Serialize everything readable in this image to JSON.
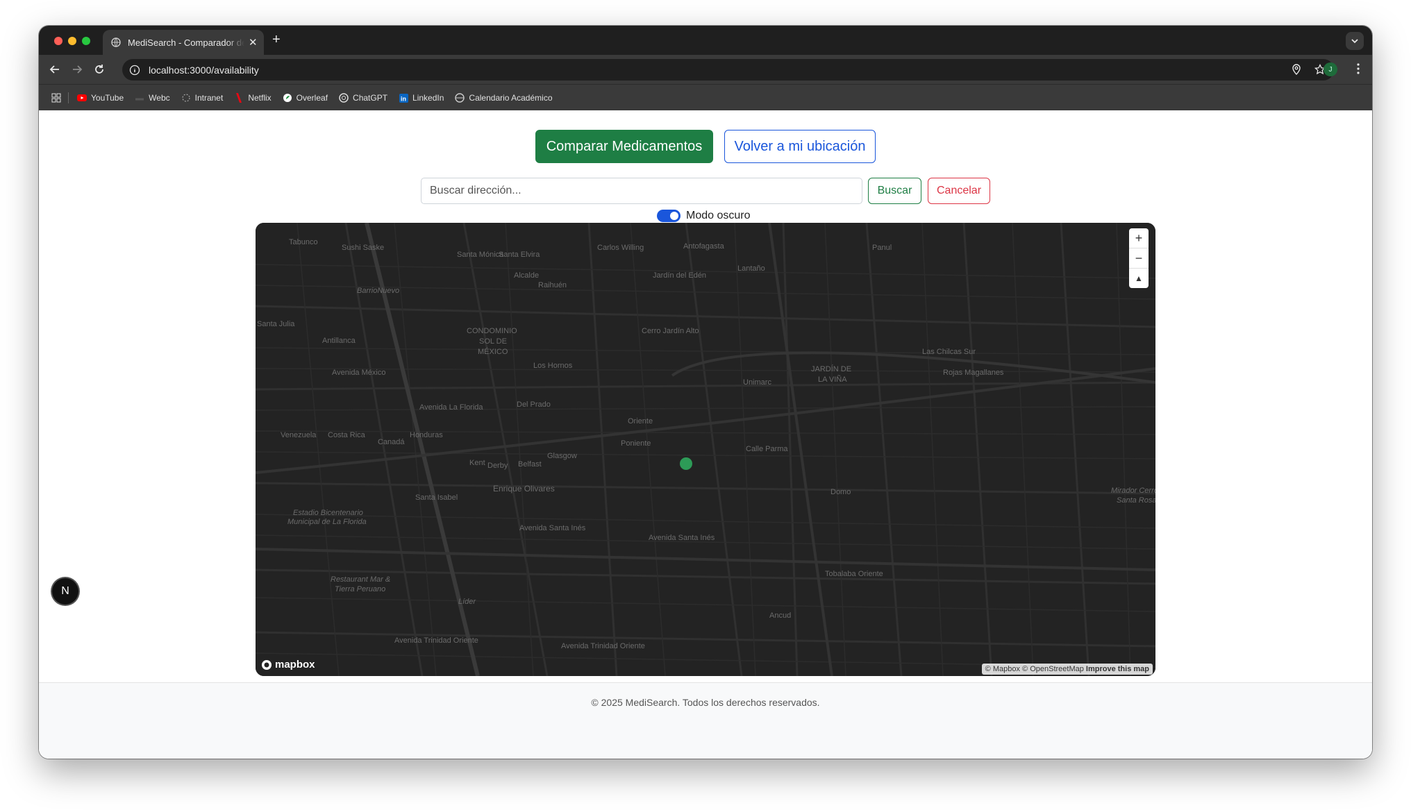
{
  "browser": {
    "tab_title": "MediSearch - Comparador de Medicamentos",
    "url": "localhost:3000/availability",
    "profile_initial": "J",
    "bookmarks": [
      {
        "label": "YouTube",
        "icon": "youtube-icon"
      },
      {
        "label": "Webc",
        "icon": "webc-icon"
      },
      {
        "label": "Intranet",
        "icon": "intranet-icon"
      },
      {
        "label": "Netflix",
        "icon": "netflix-icon"
      },
      {
        "label": "Overleaf",
        "icon": "overleaf-icon"
      },
      {
        "label": "ChatGPT",
        "icon": "chatgpt-icon"
      },
      {
        "label": "LinkedIn",
        "icon": "linkedin-icon"
      },
      {
        "label": "Calendario Académico",
        "icon": "globe-icon"
      }
    ]
  },
  "page": {
    "compare_button": "Comparar Medicamentos",
    "back_location_button": "Volver a mi ubicación",
    "search_placeholder": "Buscar dirección...",
    "search_button": "Buscar",
    "cancel_button": "Cancelar",
    "dark_mode_label": "Modo oscuro",
    "dark_mode_on": true,
    "footer_text": "© 2025 MediSearch. Todos los derechos reservados."
  },
  "map": {
    "labels": [
      "Tabunco",
      "Sushi Saske",
      "BarrioNuevo",
      "Santa Julia",
      "Antillanca",
      "Santa Mónica",
      "Santa Elvira",
      "Alcalde",
      "Raihuén",
      "Carlos Willing",
      "Antofagasta",
      "Jardín del Edén",
      "Panul",
      "CONDOMINIO",
      "SOL DE",
      "MÉXICO",
      "Los Hornos",
      "Cerro Jardín Alto",
      "Avenida México",
      "JARDÍN DE",
      "LA VIÑA",
      "Rojas Magallanes",
      "Las Chilcas Sur",
      "Del Prado",
      "Avenida La Florida",
      "Enrique Olivares",
      "Santa Isabel",
      "Estadio Bicentenario",
      "Municipal de La Florida",
      "Avenida Santa Inés",
      "Avenida Santa Inés",
      "Domo",
      "Mirador Cerro",
      "Santa Rosa",
      "Restaurant Mar &",
      "Tierra Peruano",
      "Líder",
      "Avenida Trinidad Oriente",
      "Avenida Trinidad Oriente",
      "Tobalaba Oriente",
      "Calle Parma",
      "Unimarc",
      "Lantaño",
      "Venezuela",
      "Costa Rica",
      "Canadá",
      "Honduras",
      "Glasgow",
      "Belfast",
      "Derby",
      "Kent",
      "Poniente",
      "Oriente",
      "Ancud"
    ],
    "attribution_mapbox": "© Mapbox",
    "attribution_osm": "© OpenStreetMap",
    "attribution_improve": "Improve this map",
    "logo_text": "mapbox"
  },
  "colors": {
    "primary_green": "#1e7e44",
    "primary_blue": "#1a56db",
    "danger_red": "#dc3545",
    "map_bg": "#222222",
    "marker": "#2d9b57"
  },
  "dev_badge": "N"
}
